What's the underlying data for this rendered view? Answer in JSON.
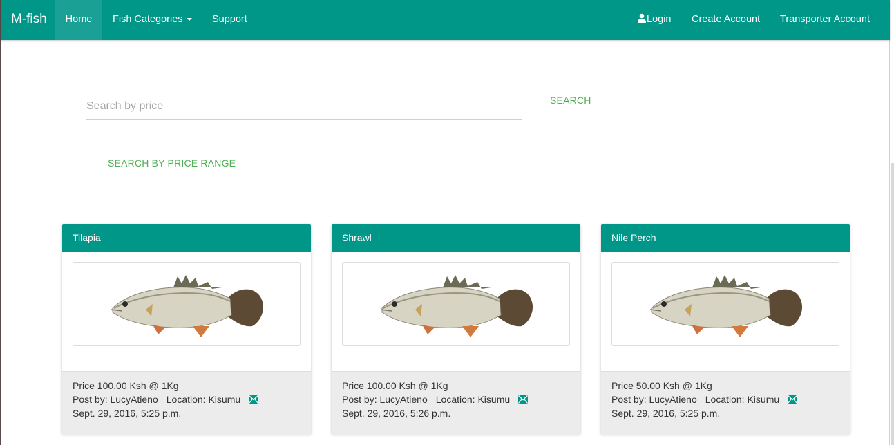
{
  "navbar": {
    "brand": "M-fish",
    "home": "Home",
    "categories": "Fish Categories",
    "support": "Support",
    "login": "Login",
    "create_account": "Create Account",
    "transporter_account": "Transporter Account"
  },
  "search": {
    "placeholder": "Search by price",
    "button_label": "SEARCH",
    "range_label": "SEARCH BY PRICE RANGE"
  },
  "colors": {
    "primary": "#009688",
    "accent_green": "#4caf50"
  },
  "cards": [
    {
      "title": "Tilapia",
      "price": "Price 100.00 Ksh @ 1Kg",
      "posted_by": "Post by: LucyAtieno",
      "location": "Location: Kisumu",
      "date": "Sept. 29, 2016, 5:25 p.m.",
      "icon": "envelope-icon"
    },
    {
      "title": "Shrawl",
      "price": "Price 100.00 Ksh @ 1Kg",
      "posted_by": "Post by: LucyAtieno",
      "location": "Location: Kisumu",
      "date": "Sept. 29, 2016, 5:26 p.m.",
      "icon": "envelope-icon"
    },
    {
      "title": "Nile Perch",
      "price": "Price 50.00 Ksh @ 1Kg",
      "posted_by": "Post by: LucyAtieno",
      "location": "Location: Kisumu",
      "date": "Sept. 29, 2016, 5:25 p.m.",
      "icon": "envelope-icon"
    }
  ]
}
